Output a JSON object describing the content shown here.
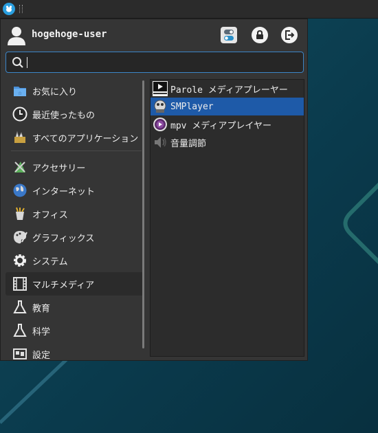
{
  "top_panel": {
    "app_button_icon": "xfce-mouse-icon"
  },
  "user": {
    "name": "hogehoge-user"
  },
  "actions": [
    {
      "name": "settings",
      "icon": "settings-toggle-icon"
    },
    {
      "name": "lock",
      "icon": "lock-icon"
    },
    {
      "name": "logout",
      "icon": "logout-icon"
    }
  ],
  "search": {
    "value": "",
    "placeholder": ""
  },
  "categories": [
    {
      "label": "お気に入り",
      "icon": "favorites-folder-icon"
    },
    {
      "label": "最近使ったもの",
      "icon": "clock-icon"
    },
    {
      "label": "すべてのアプリケーション",
      "icon": "all-apps-icon"
    },
    {
      "label": "アクセサリー",
      "icon": "accessories-icon"
    },
    {
      "label": "インターネット",
      "icon": "globe-icon"
    },
    {
      "label": "オフィス",
      "icon": "office-icon"
    },
    {
      "label": "グラフィックス",
      "icon": "palette-icon"
    },
    {
      "label": "システム",
      "icon": "gear-icon"
    },
    {
      "label": "マルチメディア",
      "icon": "film-icon",
      "active": true
    },
    {
      "label": "教育",
      "icon": "flask-icon"
    },
    {
      "label": "科学",
      "icon": "flask-icon"
    },
    {
      "label": "設定",
      "icon": "settings-panel-icon"
    }
  ],
  "apps": [
    {
      "label": "Parole メディアプレーヤー",
      "icon": "parole-play-icon"
    },
    {
      "label": "SMPlayer",
      "icon": "smplayer-icon",
      "selected": true
    },
    {
      "label": "mpv メディアプレイヤー",
      "icon": "mpv-icon"
    },
    {
      "label": "音量調節",
      "icon": "speaker-icon"
    }
  ],
  "colors": {
    "accent": "#1e5aa8",
    "search_border": "#3c86c9",
    "menu_bg": "#353535"
  }
}
